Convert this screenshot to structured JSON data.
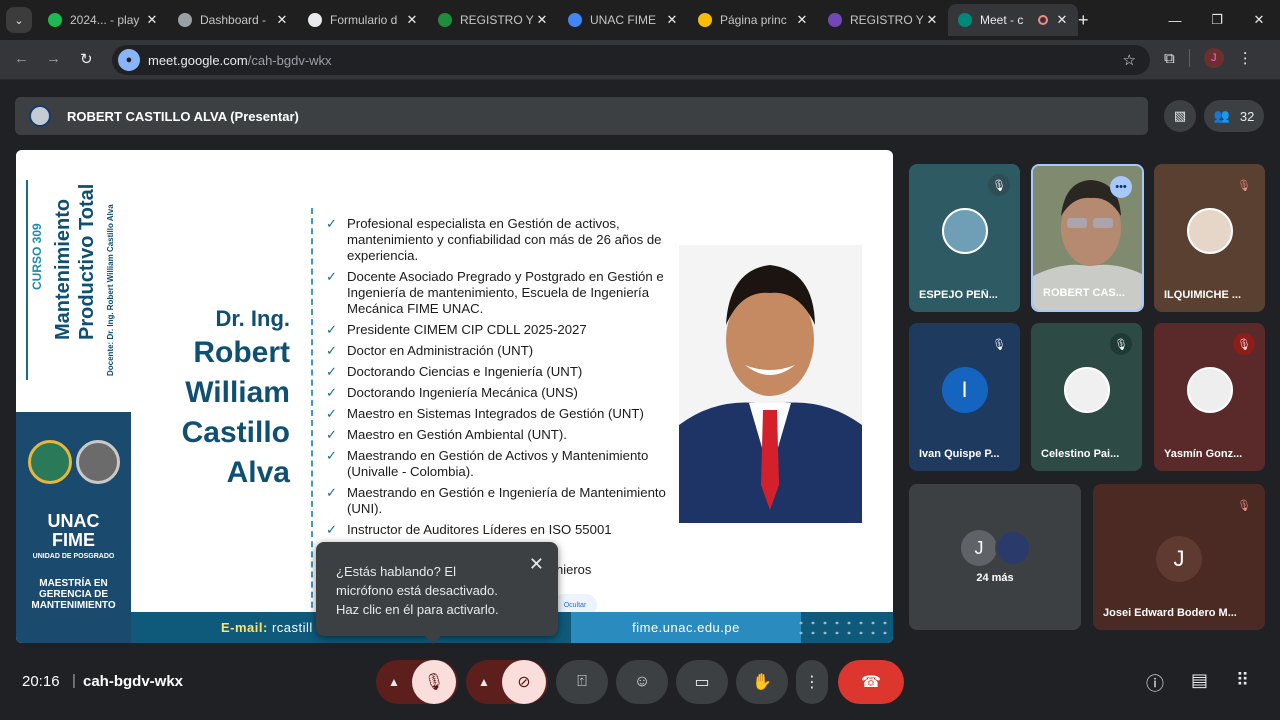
{
  "browser": {
    "tabs": [
      {
        "title": "2024... - play",
        "fav": "#1db954",
        "icon": "spotify-icon"
      },
      {
        "title": "Dashboard -",
        "fav": "#9aa0a6",
        "icon": "globe-icon"
      },
      {
        "title": "Formulario d",
        "fav": "#e8eaed",
        "icon": "form-icon"
      },
      {
        "title": "REGISTRO Y",
        "fav": "#1e8e3e",
        "icon": "sheets-icon"
      },
      {
        "title": "UNAC FIME",
        "fav": "#4285f4",
        "icon": "google-icon"
      },
      {
        "title": "Página princ",
        "fav": "#fbbc04",
        "icon": "drive-icon"
      },
      {
        "title": "REGISTRO Y",
        "fav": "#7248b9",
        "icon": "forms-icon"
      },
      {
        "title": "Meet - c",
        "fav": "#00897b",
        "icon": "meet-icon"
      }
    ],
    "url_host": "meet.google.com",
    "url_path": "/cah-bgdv-wkx",
    "profile_initial": "J"
  },
  "presenter": {
    "name": "ROBERT CASTILLO ALVA (Presentar)",
    "participant_count": "32"
  },
  "slide": {
    "course": "CURSO 309",
    "course_title_1": "Mantenimiento",
    "course_title_2": "Productivo Total",
    "docente": "Docente: Dr. Ing. Robert William Castillo Alva",
    "unac": "UNAC",
    "fime": "FIME",
    "posgrado": "UNIDAD DE POSGRADO",
    "maestria_1": "MAESTRÍA EN",
    "maestria_2": "GERENCIA DE",
    "maestria_3": "MANTENIMIENTO",
    "dr": "Dr. Ing.",
    "name_lines": [
      "Robert",
      "William",
      "Castillo",
      "Alva"
    ],
    "bullets": [
      "Profesional especialista en Gestión de activos, mantenimiento y confiabilidad con más de 26 años de experiencia.",
      "Docente Asociado Pregrado y Postgrado en Gestión e Ingeniería de mantenimiento, Escuela de Ingeniería Mecánica FIME UNAC.",
      "Presidente CIMEM CIP CDLL 2025-2027",
      "Doctor en Administración (UNT)",
      "Doctorando Ciencias e Ingeniería (UNT)",
      "Doctorando Ingeniería Mecánica (UNS)",
      "Maestro en Sistemas Integrados de Gestión (UNT)",
      "Maestro en Gestión Ambiental (UNT).",
      "Maestrando en Gestión de Activos y Mantenimiento (Univalle - Colombia).",
      "Maestrando en Gestión e Ingeniería de Mantenimiento (UNI).",
      "Instructor de Auditores Líderes en ISO 55001"
    ],
    "partial_line": "nieros",
    "email_label": "E-mail:",
    "email_value": "rcastill",
    "website": "fime.unac.edu.pe",
    "ocultar": "Ocultar"
  },
  "tooltip": {
    "text": "¿Estás hablando? El micrófono está desactivado. Haz clic en él para activarlo."
  },
  "participants": [
    {
      "name": "ESPEJO PEÑ...",
      "muted": true
    },
    {
      "name": "ROBERT CAS...",
      "muted": false,
      "speaking": true
    },
    {
      "name": "ILQUIMICHE ...",
      "muted": true
    },
    {
      "name": "Ivan Quispe P...",
      "initial": "I",
      "muted": true
    },
    {
      "name": "Celestino Pai...",
      "muted": true
    },
    {
      "name": "Yasmín Gonz...",
      "muted": true
    }
  ],
  "more": {
    "initial": "J",
    "label": "24 más"
  },
  "last_tile": {
    "name": "Josei Edward Bodero M...",
    "initial": "J"
  },
  "bottom": {
    "time": "20:16",
    "separator": "|",
    "meeting_code": "cah-bgdv-wkx"
  }
}
